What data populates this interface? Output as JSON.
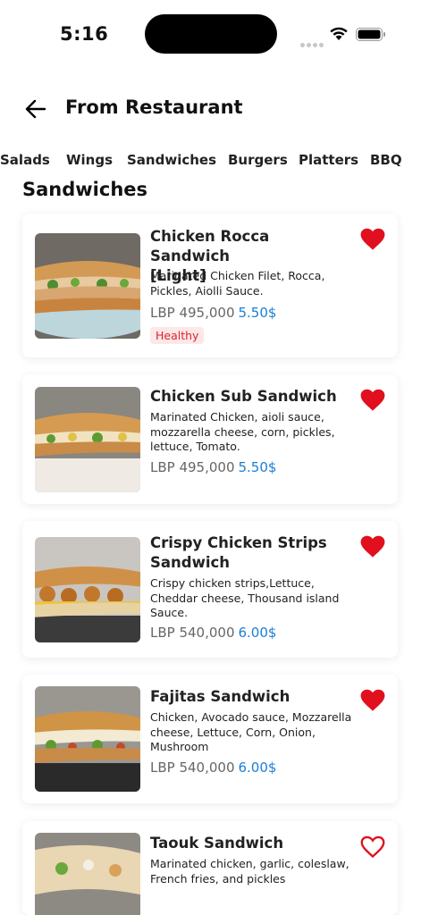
{
  "status": {
    "time": "5:16"
  },
  "header": {
    "title": "From Restaurant"
  },
  "categories": [
    "Salads",
    "Wings",
    "Sandwiches",
    "Burgers",
    "Platters",
    "BBQ"
  ],
  "section": {
    "title": "Sandwiches"
  },
  "colors": {
    "accent": "#1a7fd6",
    "heart": "#e0101e",
    "tag_text": "#d8252a",
    "tag_bg": "#fde7e8"
  },
  "items": [
    {
      "title_lines": [
        "Chicken Rocca Sandwich",
        "[Light]"
      ],
      "description_lines": [
        "Marinated Chicken Filet, Rocca,",
        "Pickles, Aiolli Sauce."
      ],
      "price_lbp": "LBP 495,000",
      "price_usd": "5.50$",
      "tag": "Healthy",
      "favorite": true,
      "icon": "heart-filled-icon"
    },
    {
      "title_lines": [
        "Chicken Sub Sandwich"
      ],
      "description_lines": [
        "Marinated Chicken, aioli sauce,",
        "mozzarella cheese, corn, pickles,",
        "lettuce, Tomato."
      ],
      "price_lbp": "LBP 495,000",
      "price_usd": "5.50$",
      "favorite": true,
      "icon": "heart-filled-icon"
    },
    {
      "title_lines": [
        "Crispy Chicken Strips",
        "Sandwich"
      ],
      "description_lines": [
        "Crispy chicken strips,Lettuce,",
        "Cheddar cheese,  Thousand island",
        "Sauce."
      ],
      "price_lbp": "LBP 540,000",
      "price_usd": "6.00$",
      "favorite": true,
      "icon": "heart-filled-icon"
    },
    {
      "title_lines": [
        "Fajitas Sandwich"
      ],
      "description_lines": [
        "Chicken, Avocado sauce, Mozzarella",
        "cheese, Lettuce, Corn, Onion,",
        "Mushroom"
      ],
      "price_lbp": "LBP 540,000",
      "price_usd": "6.00$",
      "favorite": true,
      "icon": "heart-filled-icon"
    },
    {
      "title_lines": [
        "Taouk Sandwich"
      ],
      "description_lines": [
        "Marinated chicken, garlic, coleslaw,",
        "French fries, and pickles"
      ],
      "favorite": false,
      "icon": "heart-outline-icon"
    }
  ]
}
